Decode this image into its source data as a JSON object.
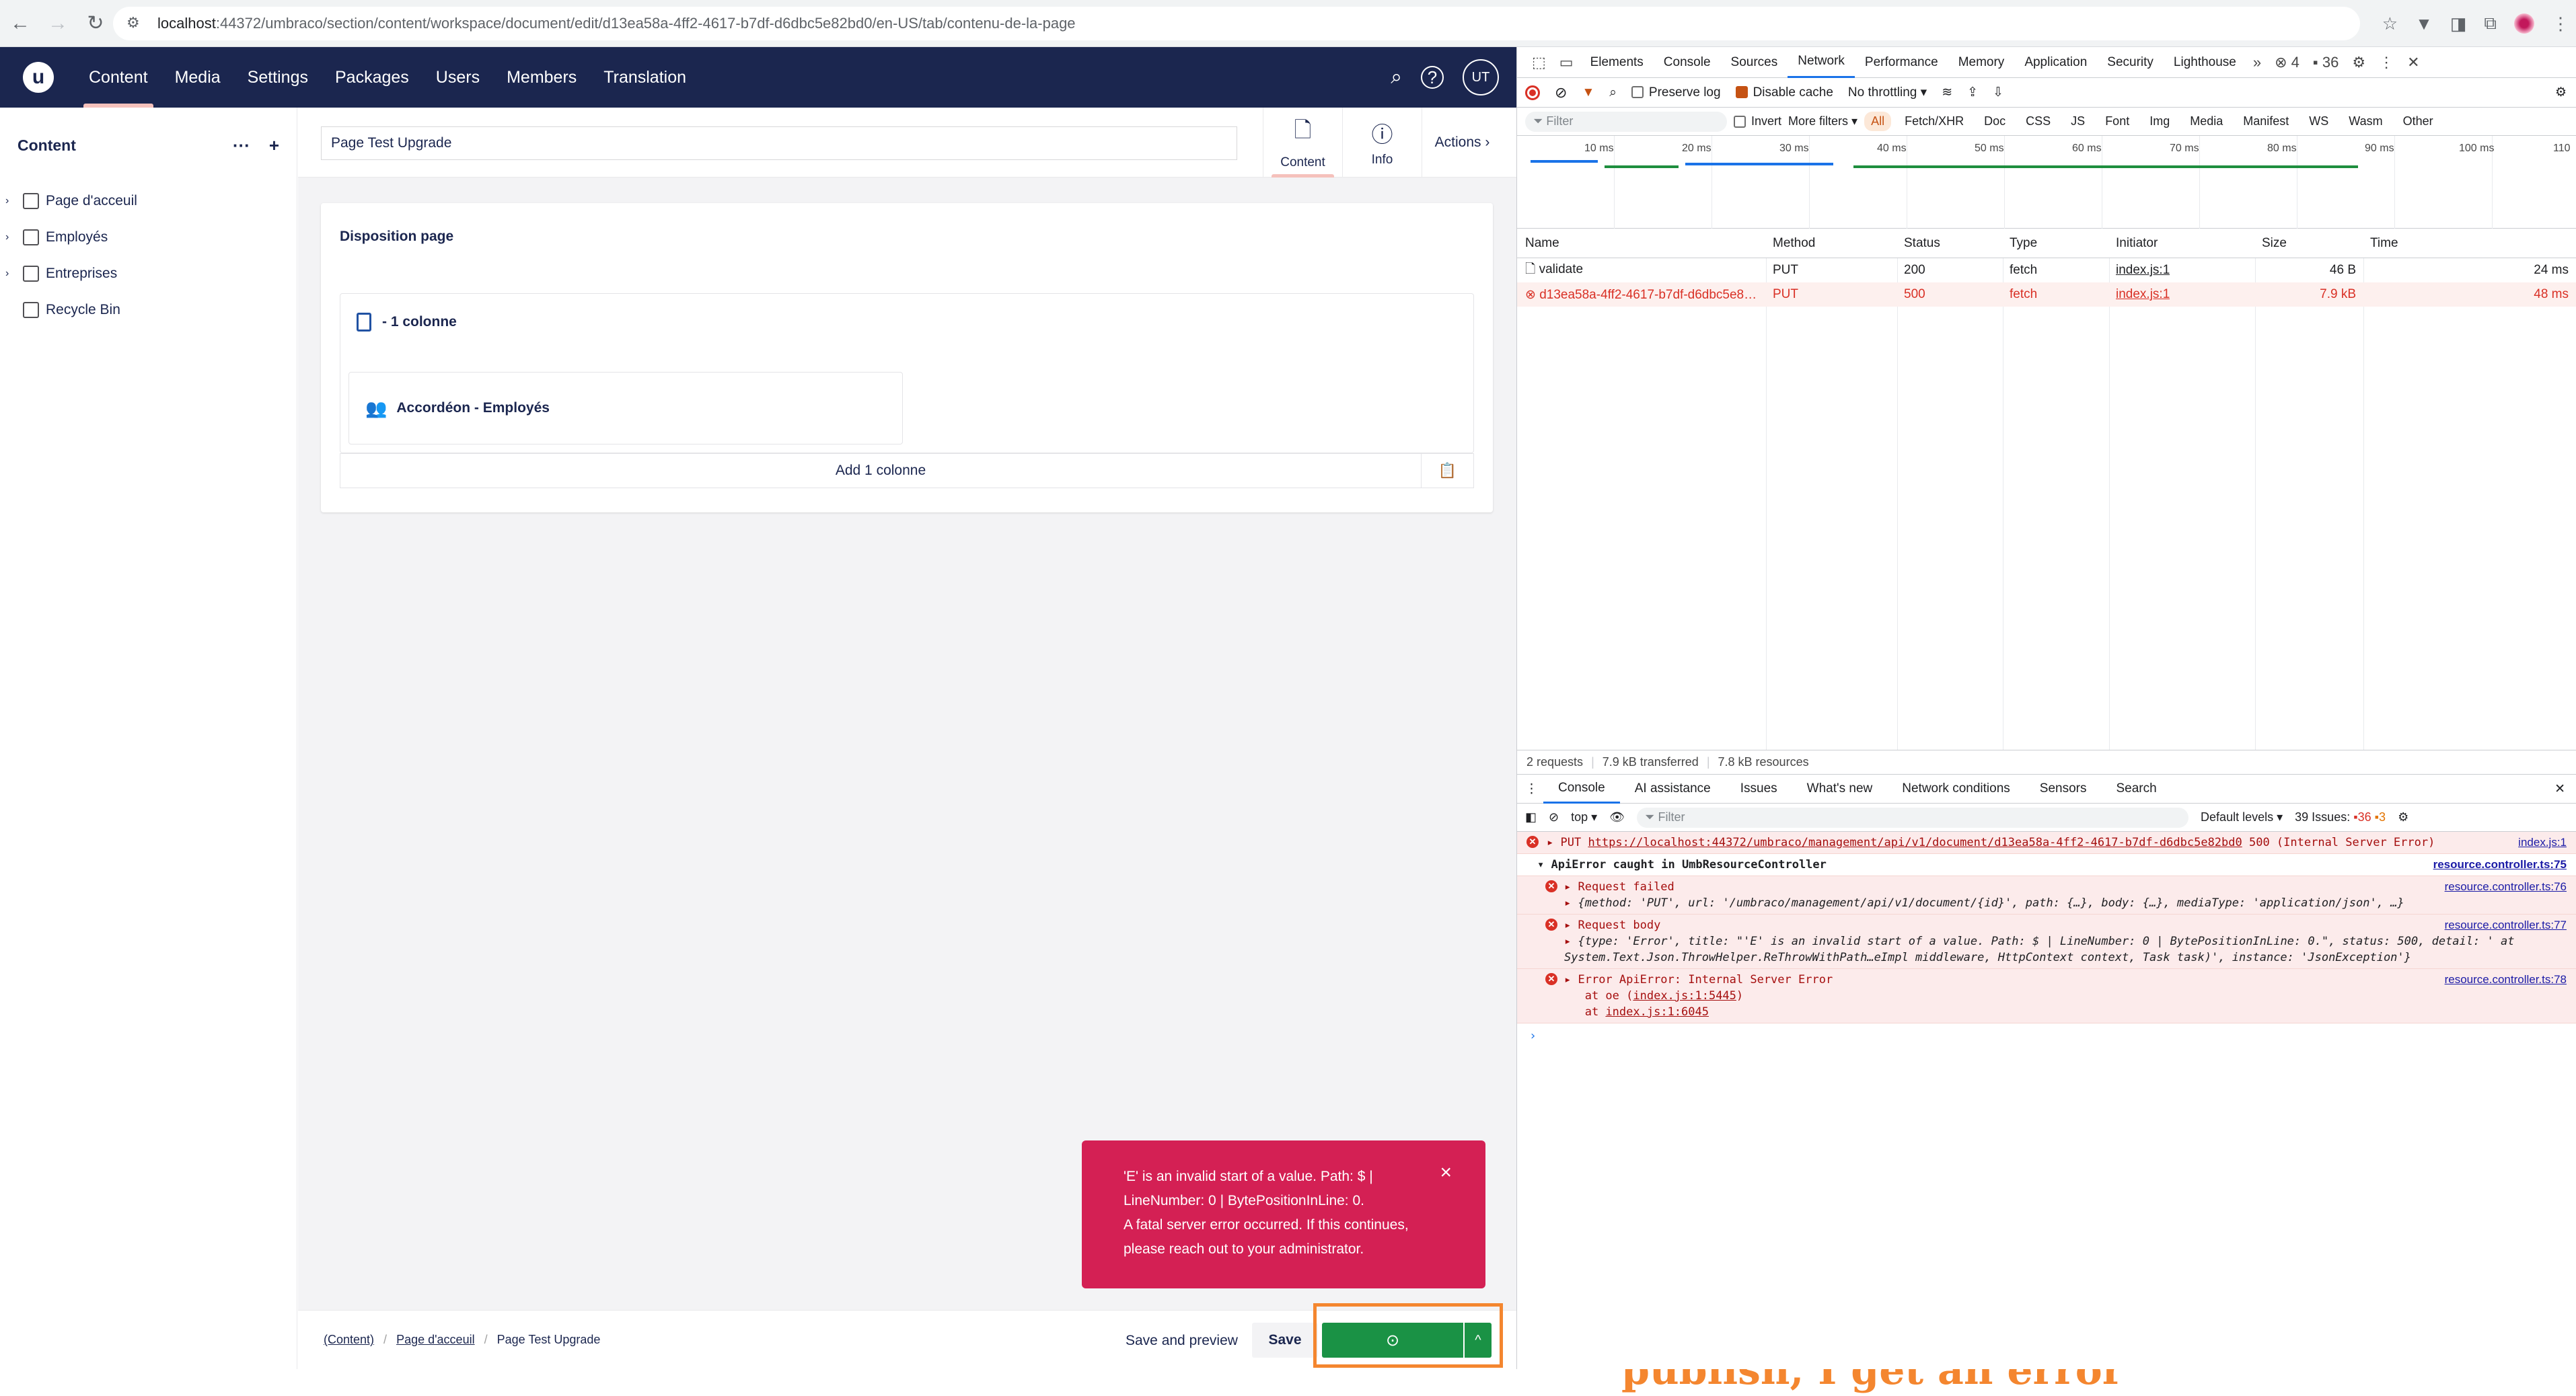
{
  "browser": {
    "url_host": "localhost",
    "url_path": ":44372/umbraco/section/content/workspace/document/edit/d13ea58a-4ff2-4617-b7df-d6dbc5e82bd0/en-US/tab/contenu-de-la-page"
  },
  "header": {
    "sections": [
      "Content",
      "Media",
      "Settings",
      "Packages",
      "Users",
      "Members",
      "Translation"
    ],
    "user_initials": "UT"
  },
  "tree": {
    "title": "Content",
    "items": [
      "Page d'acceuil",
      "Employés",
      "Entreprises",
      "Recycle Bin"
    ]
  },
  "workspace": {
    "document_name": "Page Test Upgrade",
    "tabs": [
      "Content",
      "Info"
    ],
    "actions_label": "Actions",
    "card_title": "Disposition page",
    "block_label": "- 1 colonne",
    "inner_block_label": "Accordéon - Employés",
    "add_label": "Add 1 colonne"
  },
  "toast": {
    "line1": "'E' is an invalid start of a value. Path: $ | LineNumber: 0 | BytePositionInLine: 0.",
    "line2": "A fatal server error occurred. If this continues, please reach out to your administrator."
  },
  "footer": {
    "crumbs": [
      "(Content)",
      "Page d'acceuil",
      "Page Test Upgrade"
    ],
    "preview_label": "Save and preview",
    "save_label": "Save"
  },
  "annotation": {
    "text": "Without any modifications, just by clicking on save and publish, I get an error",
    "color": "#f4862f"
  },
  "devtools": {
    "tabs": [
      "Elements",
      "Console",
      "Sources",
      "Network",
      "Performance",
      "Memory",
      "Application",
      "Security",
      "Lighthouse"
    ],
    "error_count": "4",
    "warning_count": "36",
    "toolbar": {
      "preserve_log": "Preserve log",
      "disable_cache": "Disable cache",
      "throttling": "No throttling"
    },
    "filter": {
      "placeholder": "Filter",
      "invert": "Invert",
      "more_filters": "More filters",
      "types": [
        "All",
        "Fetch/XHR",
        "Doc",
        "CSS",
        "JS",
        "Font",
        "Img",
        "Media",
        "Manifest",
        "WS",
        "Wasm",
        "Other"
      ]
    },
    "timeline_ticks": [
      "10 ms",
      "20 ms",
      "30 ms",
      "40 ms",
      "50 ms",
      "60 ms",
      "70 ms",
      "80 ms",
      "90 ms",
      "100 ms",
      "110"
    ],
    "columns": [
      "Name",
      "Method",
      "Status",
      "Type",
      "Initiator",
      "Size",
      "Time"
    ],
    "requests": [
      {
        "name": "validate",
        "method": "PUT",
        "status": "200",
        "type": "fetch",
        "initiator": "index.js:1",
        "size": "46 B",
        "time": "24 ms",
        "error": false
      },
      {
        "name": "d13ea58a-4ff2-4617-b7df-d6dbc5e82bd0",
        "method": "PUT",
        "status": "500",
        "type": "fetch",
        "initiator": "index.js:1",
        "size": "7.9 kB",
        "time": "48 ms",
        "error": true
      }
    ],
    "summary": [
      "2 requests",
      "7.9 kB transferred",
      "7.8 kB resources"
    ],
    "drawer_tabs": [
      "Console",
      "AI assistance",
      "Issues",
      "What's new",
      "Network conditions",
      "Sensors",
      "Search"
    ],
    "console": {
      "context": "top",
      "filter_placeholder": "Filter",
      "levels": "Default levels",
      "issues_label": "39 Issues:",
      "issues_err": "36",
      "issues_warn": "3",
      "put_prefix": "PUT ",
      "put_url": "https://localhost:44372/umbraco/management/api/v1/document/d13ea58a-4ff2-4617-b7df-d6dbc5e82bd0",
      "put_status": " 500 (Internal Server Error)",
      "put_src": "index.js:1",
      "group_title": "ApiError caught in UmbResourceController",
      "group_src": "resource.controller.ts:75",
      "m1_title": "Request failed",
      "m1_body": "{method: 'PUT', url: '/umbraco/management/api/v1/document/{id}', path: {…}, body: {…}, mediaType: 'application/json', …}",
      "m1_src": "resource.controller.ts:76",
      "m2_title": "Request body",
      "m2_body": "{type: 'Error', title: \"'E' is an invalid start of a value. Path: $ | LineNumber: 0 | BytePositionInLine: 0.\", status: 500, detail: '   at System.Text.Json.ThrowHelper.ReThrowWithPath…eImpl middleware, HttpContext context, Task task)', instance: 'JsonException'}",
      "m2_src": "resource.controller.ts:77",
      "m3_title": "Error ApiError: Internal Server Error",
      "m3_line2_prefix": "at oe (",
      "m3_line2_link": "index.js:1:5445",
      "m3_line2_suffix": ")",
      "m3_line3_prefix": "at ",
      "m3_line3_link": "index.js:1:6045",
      "m3_src": "resource.controller.ts:78"
    }
  }
}
